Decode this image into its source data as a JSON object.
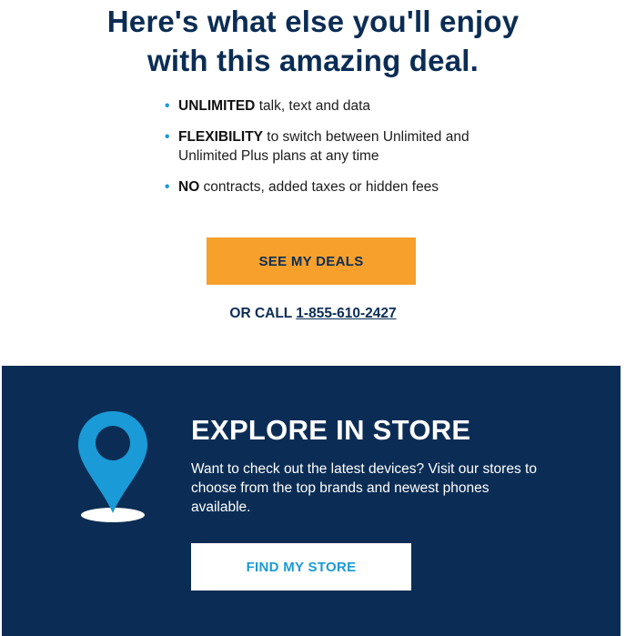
{
  "headline": {
    "line1": "Here's what else you'll enjoy",
    "line2": "with this amazing deal."
  },
  "benefits": [
    {
      "bullet": "•",
      "bold": "UNLIMITED",
      "text": " talk, text and data"
    },
    {
      "bullet": "•",
      "bold": "FLEXIBILITY",
      "text": " to switch between Unlimited and Unlimited Plus plans at any time"
    },
    {
      "bullet": "•",
      "bold": "NO",
      "text": " contracts, added taxes or hidden fees"
    }
  ],
  "deals_button": {
    "label": "SEE MY DEALS",
    "color": "#f7a02b"
  },
  "call": {
    "prefix": "OR CALL ",
    "phone": "1-855-610-2427"
  },
  "store_section": {
    "icon": "location-pin-icon",
    "title": "EXPLORE IN STORE",
    "text": "Want to check out the latest devices? Visit our stores to choose from the top brands and newest phones available.",
    "button_label": "FIND MY STORE",
    "background": "#0b2d55",
    "accent": "#1a9ad6"
  }
}
